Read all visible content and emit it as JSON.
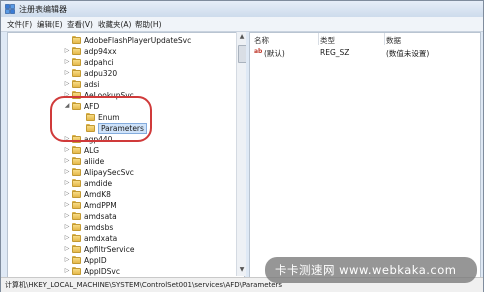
{
  "window": {
    "title": "注册表编辑器"
  },
  "menu": [
    "文件(F)",
    "编辑(E)",
    "查看(V)",
    "收藏夹(A)",
    "帮助(H)"
  ],
  "tree": {
    "items": [
      {
        "label": "AdobeFlashPlayerUpdateSvc",
        "expander": "",
        "indent": 1
      },
      {
        "label": "adp94xx",
        "expander": "▷",
        "indent": 1
      },
      {
        "label": "adpahci",
        "expander": "▷",
        "indent": 1
      },
      {
        "label": "adpu320",
        "expander": "▷",
        "indent": 1
      },
      {
        "label": "adsi",
        "expander": "▷",
        "indent": 1
      },
      {
        "label": "AeLookupSvc",
        "expander": "▷",
        "indent": 1
      },
      {
        "label": "AFD",
        "expander": "◢",
        "indent": 1
      },
      {
        "label": "Enum",
        "expander": "",
        "indent": 2
      },
      {
        "label": "Parameters",
        "expander": "",
        "indent": 2,
        "selected": true
      },
      {
        "label": "agp440",
        "expander": "▷",
        "indent": 1
      },
      {
        "label": "ALG",
        "expander": "▷",
        "indent": 1
      },
      {
        "label": "aliide",
        "expander": "▷",
        "indent": 1
      },
      {
        "label": "AlipaySecSvc",
        "expander": "▷",
        "indent": 1
      },
      {
        "label": "amdide",
        "expander": "▷",
        "indent": 1
      },
      {
        "label": "AmdK8",
        "expander": "▷",
        "indent": 1
      },
      {
        "label": "AmdPPM",
        "expander": "▷",
        "indent": 1
      },
      {
        "label": "amdsata",
        "expander": "▷",
        "indent": 1
      },
      {
        "label": "amdsbs",
        "expander": "▷",
        "indent": 1
      },
      {
        "label": "amdxata",
        "expander": "▷",
        "indent": 1
      },
      {
        "label": "ApfiltrService",
        "expander": "▷",
        "indent": 1
      },
      {
        "label": "AppID",
        "expander": "▷",
        "indent": 1
      },
      {
        "label": "AppIDSvc",
        "expander": "▷",
        "indent": 1
      }
    ]
  },
  "values": {
    "columns": [
      "名称",
      "类型",
      "数据"
    ],
    "rows": [
      {
        "name": "(默认)",
        "type": "REG_SZ",
        "data": "(数值未设置)",
        "icon": "ab"
      }
    ]
  },
  "status": "计算机\\HKEY_LOCAL_MACHINE\\SYSTEM\\ControlSet001\\services\\AFD\\Parameters",
  "watermark": "卡卡测速网 www.webkaka.com",
  "colors": {
    "selection": "#cfe3fa",
    "highlight_ring": "#d03a3a",
    "folder": "#e5b84b"
  }
}
